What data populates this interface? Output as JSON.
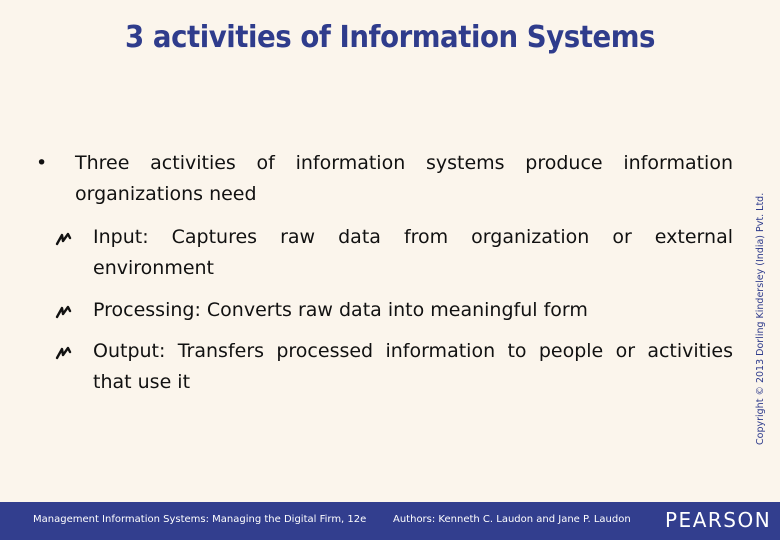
{
  "slide": {
    "title": "3 activities of Information Systems",
    "main_bullet": {
      "marker": "•",
      "text": "Three activities of information systems produce information organizations need"
    },
    "sub_bullets": [
      {
        "icon": "squiggle-arrow-icon",
        "text": "Input: Captures raw data from organization or external environment"
      },
      {
        "icon": "squiggle-arrow-icon",
        "text": "Processing: Converts raw data into meaningful form"
      },
      {
        "icon": "squiggle-arrow-icon",
        "text": "Output: Transfers processed information to people or activities that use it"
      }
    ],
    "copyright": "Copyright © 2013 Dorling Kindersley (India) Pvt. Ltd."
  },
  "footer": {
    "book": "Management Information Systems: Managing the Digital Firm, 12e",
    "authors": "Authors: Kenneth C. Laudon and Jane P. Laudon",
    "logo": "PEARSON"
  },
  "colors": {
    "title": "#2f3c8c",
    "footer_bg": "#323e8e",
    "background": "#fbf5ec"
  }
}
